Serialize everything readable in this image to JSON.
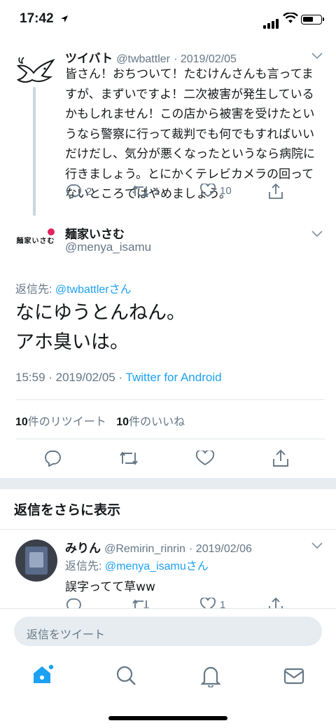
{
  "status": {
    "time": "17:42"
  },
  "parent_tweet": {
    "name": "ツイバト",
    "handle": "@twbattler",
    "date": "· 2019/02/05",
    "lines": [
      "皆さん！おちついて！たむけんさんも言ってま",
      "すが、まずいですよ！二次被害が発生している",
      "かもしれません！この店から被害を受けたとい",
      "うなら警察に行って裁判でも何でもすればいい",
      "だけだし、気分が悪くなったというなら病院に",
      "行きましょう。とにかくテレビカメラの回って",
      "ないところではやめましょう。"
    ],
    "replies": "2",
    "retweets": "1",
    "likes": "10"
  },
  "main_tweet": {
    "name": "麺家いさむ",
    "handle": "@menya_isamu",
    "avatar_text": "麺家いさむ",
    "reply_prefix": "返信先: ",
    "reply_to": "@twbattler",
    "reply_suffix": "さん",
    "line1": "なにゆうとんねん。",
    "line2": "アホ臭いは。",
    "timestamp": "15:59 · 2019/02/05 · ",
    "client": "Twitter for Android",
    "rt_count": "10",
    "rt_label": "件のリツイート",
    "like_count": "10",
    "like_label": "件のいいね"
  },
  "more_replies": {
    "title": "返信をさらに表示"
  },
  "reply_tweet": {
    "name": "みりん",
    "handle": "@Remirin_rinrin",
    "date": "· 2019/02/06",
    "reply_prefix": "返信先: ",
    "reply_to": "@menya_isamu",
    "reply_suffix": "さん",
    "text": "誤字ってて草ww",
    "likes": "1"
  },
  "compose": {
    "placeholder": "返信をツイート"
  },
  "colors": {
    "link": "#1da1f2",
    "muted": "#657786",
    "divider": "#e1e8ed"
  }
}
